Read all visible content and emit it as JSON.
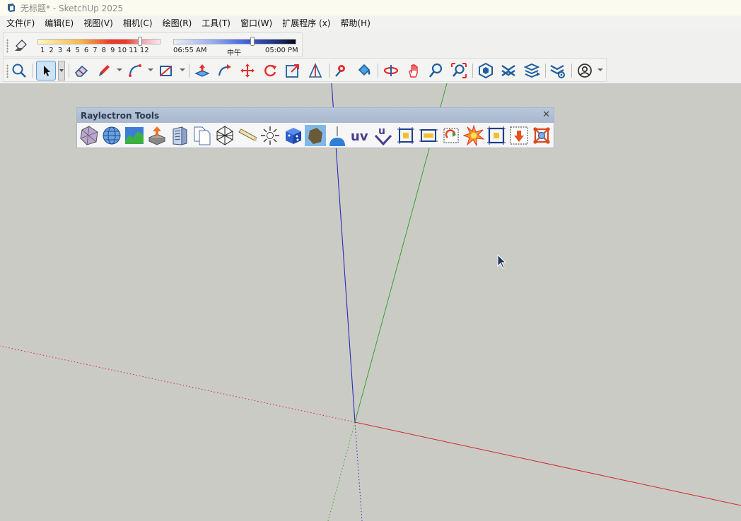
{
  "window": {
    "title": "无标题* - SketchUp 2025"
  },
  "menu": [
    "文件(F)",
    "编辑(E)",
    "视图(V)",
    "相机(C)",
    "绘图(R)",
    "工具(T)",
    "窗口(W)",
    "扩展程序 (x)",
    "帮助(H)"
  ],
  "shadows": {
    "months": [
      "1",
      "2",
      "3",
      "4",
      "5",
      "6",
      "7",
      "8",
      "9",
      "10",
      "11",
      "12"
    ],
    "time_start": "06:55 AM",
    "time_mid": "中午",
    "time_end": "05:00 PM",
    "month_value": 0.85,
    "time_value": 0.65
  },
  "main_toolbar": {
    "icons": [
      "search-icon",
      "select-arrow-icon",
      "eraser-icon",
      "pencil-icon",
      "arc-icon",
      "rectangle-icon",
      "push-pull-icon",
      "follow-me-icon",
      "move-icon",
      "rotate-icon",
      "scale-icon",
      "protractor-icon",
      "tape-icon",
      "paint-bucket-icon",
      "orbit-icon",
      "pan-icon",
      "zoom-icon",
      "zoom-extents-icon",
      "warehouse-icon",
      "extension-icon",
      "layers-icon",
      "settings-icon",
      "account-icon"
    ]
  },
  "raylectron_palette": {
    "title": "Raylectron Tools",
    "close_label": "✕",
    "uv_label": "uv",
    "u_label": "u"
  },
  "colors": {
    "viewport": "#cbcbc6",
    "axis_red": "#d2262a",
    "axis_green": "#33a233",
    "axis_blue": "#2a2ab8",
    "icon_blue": "#1f5e9e"
  }
}
